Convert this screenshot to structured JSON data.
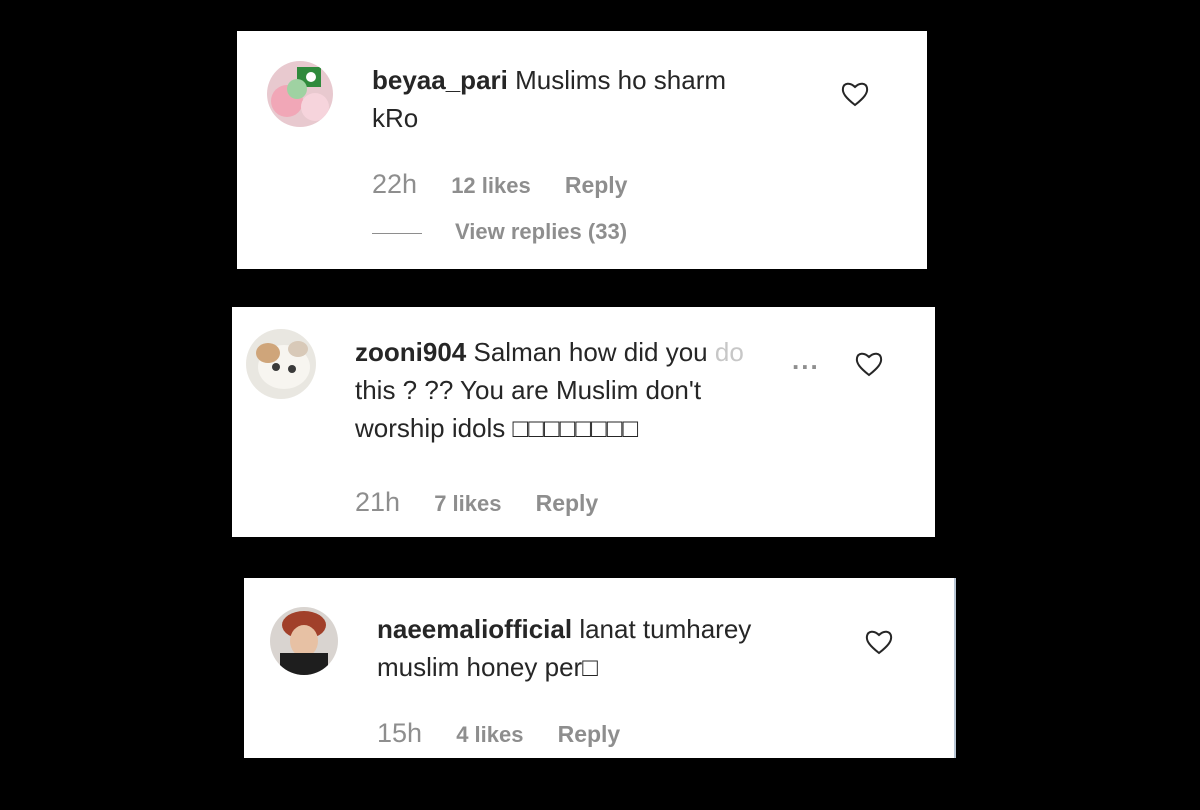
{
  "comments": [
    {
      "username": "beyaa_pari",
      "text": "Muslims ho sharm",
      "text2": "kRo",
      "time": "22h",
      "likes": "12 likes",
      "reply": "Reply",
      "view_replies": "View replies (33)"
    },
    {
      "username": "zooni904",
      "text": "Salman how did you",
      "text_faded": "do",
      "more": "...",
      "text2": "this ? ?? You are Muslim don't",
      "text3": "worship idols □□□□□□□□",
      "time": "21h",
      "likes": "7 likes",
      "reply": "Reply"
    },
    {
      "username": "naeemaliofficial",
      "text": "lanat tumharey",
      "text2": "muslim honey per□",
      "time": "15h",
      "likes": "4 likes",
      "reply": "Reply"
    }
  ],
  "icons": {
    "like": "heart-outline-icon"
  }
}
